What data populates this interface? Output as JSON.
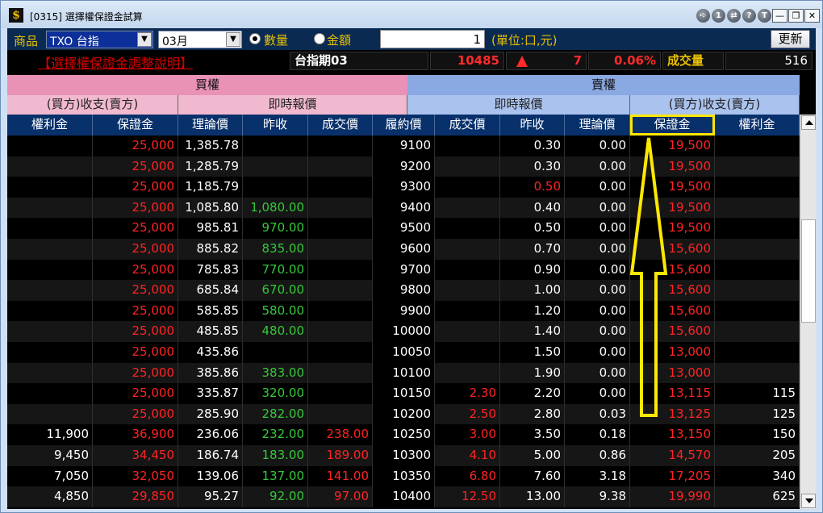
{
  "window": {
    "title": "[0315] 選擇權保證金試算",
    "title_circles": [
      "➪",
      "1",
      "⇄",
      "?",
      "T"
    ],
    "title_buttons": [
      "—",
      "❐",
      "✕"
    ]
  },
  "toolbar": {
    "product_label": "商品",
    "product_value": "TXO 台指",
    "month_value": "03月",
    "radio_qty_label": "數量",
    "radio_amount_label": "金額",
    "qty_value": "1",
    "unit_label": "(單位:口,元)",
    "refresh_label": "更新"
  },
  "quote": {
    "notice_link": "【選擇權保證金調整說明】",
    "name": "台指期03",
    "price": "10485",
    "change": "7",
    "change_pct": "0.06%",
    "volume_label": "成交量",
    "volume": "516"
  },
  "table": {
    "call_section": "買權",
    "put_section": "賣權",
    "call_sub_left": "(買方)收支(賣方)",
    "call_sub_right": "即時報價",
    "put_sub_left": "即時報價",
    "put_sub_right": "(買方)收支(賣方)",
    "columns": [
      "權利金",
      "保證金",
      "理論價",
      "昨收",
      "成交價",
      "履約價",
      "成交價",
      "昨收",
      "理論價",
      "保證金",
      "權利金"
    ],
    "rows": [
      [
        "",
        "25,000",
        "1,385.78",
        "",
        "",
        "9100",
        "",
        "0.30",
        "0.00",
        "19,500",
        ""
      ],
      [
        "",
        "25,000",
        "1,285.79",
        "",
        "",
        "9200",
        "",
        "0.30",
        "0.00",
        "19,500",
        ""
      ],
      [
        "",
        "25,000",
        "1,185.79",
        "",
        "",
        "9300",
        "",
        "0.50",
        "0.00",
        "19,500",
        ""
      ],
      [
        "",
        "25,000",
        "1,085.80",
        "1,080.00",
        "",
        "9400",
        "",
        "0.40",
        "0.00",
        "19,500",
        ""
      ],
      [
        "",
        "25,000",
        "985.81",
        "970.00",
        "",
        "9500",
        "",
        "0.50",
        "0.00",
        "19,500",
        ""
      ],
      [
        "",
        "25,000",
        "885.82",
        "835.00",
        "",
        "9600",
        "",
        "0.70",
        "0.00",
        "15,600",
        ""
      ],
      [
        "",
        "25,000",
        "785.83",
        "770.00",
        "",
        "9700",
        "",
        "0.90",
        "0.00",
        "15,600",
        ""
      ],
      [
        "",
        "25,000",
        "685.84",
        "670.00",
        "",
        "9800",
        "",
        "1.00",
        "0.00",
        "15,600",
        ""
      ],
      [
        "",
        "25,000",
        "585.85",
        "580.00",
        "",
        "9900",
        "",
        "1.20",
        "0.00",
        "15,600",
        ""
      ],
      [
        "",
        "25,000",
        "485.85",
        "480.00",
        "",
        "10000",
        "",
        "1.40",
        "0.00",
        "15,600",
        ""
      ],
      [
        "",
        "25,000",
        "435.86",
        "",
        "",
        "10050",
        "",
        "1.50",
        "0.00",
        "13,000",
        ""
      ],
      [
        "",
        "25,000",
        "385.86",
        "383.00",
        "",
        "10100",
        "",
        "1.90",
        "0.00",
        "13,000",
        ""
      ],
      [
        "",
        "25,000",
        "335.87",
        "320.00",
        "",
        "10150",
        "2.30",
        "2.20",
        "0.00",
        "13,115",
        "115"
      ],
      [
        "",
        "25,000",
        "285.90",
        "282.00",
        "",
        "10200",
        "2.50",
        "2.80",
        "0.03",
        "13,125",
        "125"
      ],
      [
        "11,900",
        "36,900",
        "236.06",
        "232.00",
        "238.00",
        "10250",
        "3.00",
        "3.50",
        "0.18",
        "13,150",
        "150"
      ],
      [
        "9,450",
        "34,450",
        "186.74",
        "183.00",
        "189.00",
        "10300",
        "4.10",
        "5.00",
        "0.86",
        "14,570",
        "205"
      ],
      [
        "7,050",
        "32,050",
        "139.06",
        "137.00",
        "141.00",
        "10350",
        "6.80",
        "7.60",
        "3.18",
        "17,205",
        "340"
      ],
      [
        "4,850",
        "29,850",
        "95.27",
        "92.00",
        "97.00",
        "10400",
        "12.50",
        "13.00",
        "9.38",
        "19,990",
        "625"
      ]
    ]
  },
  "colors": {
    "margin_red": "#ff2323",
    "price_green": "#35c83a",
    "highlight_yellow": "#ffe800",
    "call_pink": "#e992b6",
    "put_blue": "#8aa8e2"
  }
}
